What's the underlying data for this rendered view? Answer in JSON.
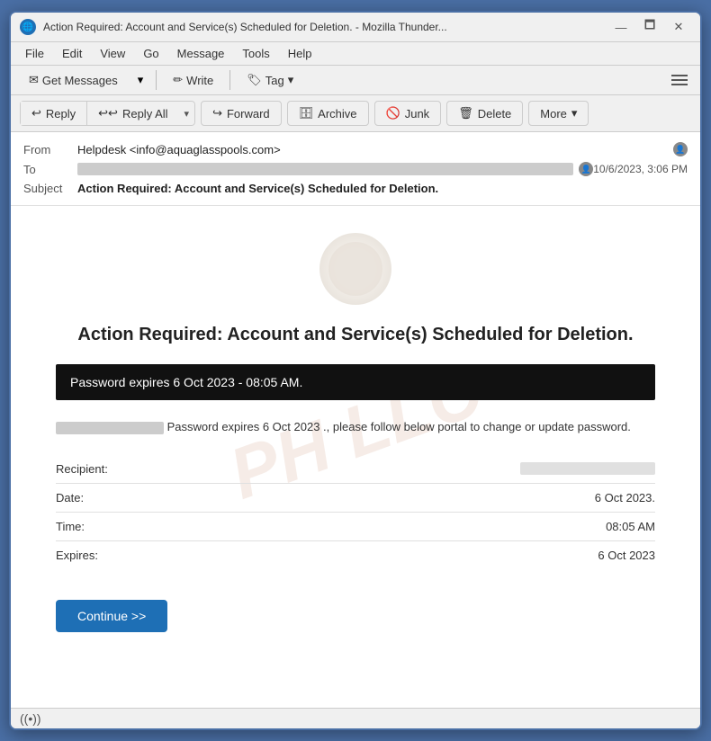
{
  "window": {
    "title": "Action Required: Account and Service(s) Scheduled for Deletion. - Mozilla Thunder...",
    "icon": "🌐"
  },
  "titlebar": {
    "minimize_label": "—",
    "maximize_label": "🗖",
    "close_label": "✕"
  },
  "menubar": {
    "items": [
      "File",
      "Edit",
      "View",
      "Go",
      "Message",
      "Tools",
      "Help"
    ]
  },
  "toolbar_top": {
    "get_messages_label": "Get Messages",
    "write_label": "Write",
    "tag_label": "Tag",
    "dropdown_arrow": "▾"
  },
  "action_bar": {
    "reply_label": "Reply",
    "reply_all_label": "Reply All",
    "forward_label": "Forward",
    "archive_label": "Archive",
    "junk_label": "Junk",
    "delete_label": "Delete",
    "more_label": "More",
    "dropdown_arrow": "▾"
  },
  "email": {
    "from_label": "From",
    "from_value": "Helpdesk <info@aquaglasspools.com>",
    "to_label": "To",
    "to_value": "[redacted]",
    "date_value": "10/6/2023, 3:06 PM",
    "subject_label": "Subject",
    "subject_value": "Action Required: Account and Service(s) Scheduled for Deletion.",
    "body": {
      "title": "Action Required: Account and Service(s) Scheduled for Deletion.",
      "password_bar": "Password expires  6 Oct 2023 - 08:05 AM.",
      "intro_text": "Password expires 6 Oct 2023 ., please follow below portal to change or update password.",
      "recipient_label": "Recipient:",
      "recipient_value": "[redacted]",
      "date_label": "Date:",
      "date_value": "6 Oct 2023.",
      "time_label": "Time:",
      "time_value": "08:05 AM",
      "expires_label": "Expires:",
      "expires_value": "6 Oct 2023",
      "continue_btn": "Continue >>"
    }
  },
  "statusbar": {
    "signal_label": "((•))"
  }
}
